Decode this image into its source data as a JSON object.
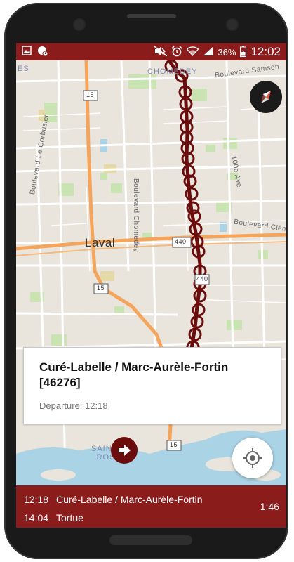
{
  "status_bar": {
    "battery_percent": "36%",
    "time": "12:02",
    "left_icons": [
      "image-icon",
      "app-notification-icon"
    ],
    "right_icons": [
      "mute-icon",
      "alarm-icon",
      "wifi-icon",
      "signal-icon",
      "battery-icon"
    ]
  },
  "map": {
    "labels": {
      "chomedey_top": "CHOMEDEY",
      "es": "ES",
      "blvd_samson": "Boulevard Samson",
      "blvd_le_corbusier": "Boulevard Le Corbusier",
      "blvd_chomedey": "Boulevard Chomedey",
      "ave_100e": "100e Ave",
      "blvd_clement": "Boulevard Clém",
      "laval": "Laval",
      "sainte_rose": "SAINTE-\nROSE"
    },
    "shields": {
      "hwy15_top": "15",
      "hwy15_mid": "15",
      "hwy15_bottom": "15",
      "hwy440": "440",
      "hwy440_b": "440"
    },
    "colors": {
      "route": "#6b0d0d",
      "highway": "#f5a55b",
      "water": "#aad3e6",
      "park": "#c9e4b2"
    }
  },
  "stop_card": {
    "title": "Curé-Labelle / Marc-Aurèle-Fortin [46276]",
    "departure": "Departure: 12:18"
  },
  "trip": {
    "rows": [
      {
        "time": "12:18",
        "stop": "Curé-Labelle / Marc-Aurèle-Fortin"
      },
      {
        "time": "14:04",
        "stop": "Tortue"
      }
    ],
    "duration": "1:46"
  },
  "colors": {
    "accent": "#8a1c1c",
    "pin": "#6b0d0d"
  }
}
